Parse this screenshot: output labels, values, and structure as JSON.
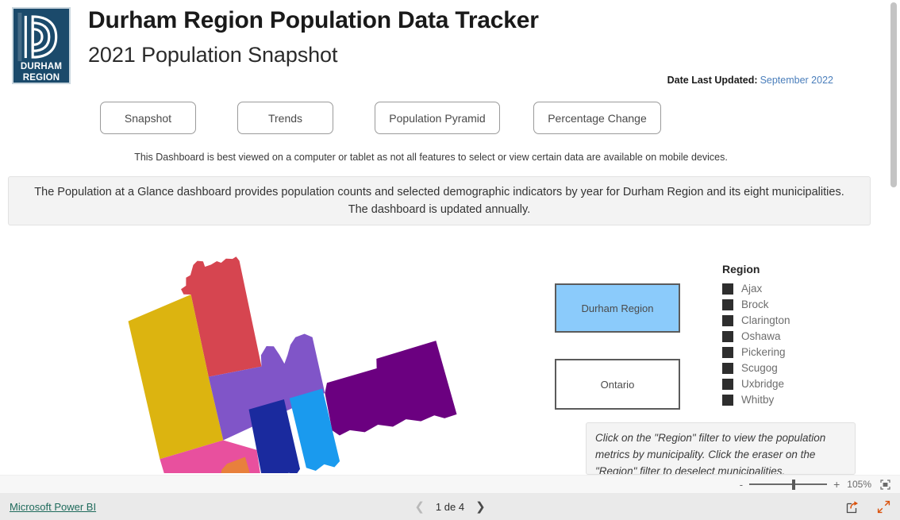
{
  "header": {
    "logo_line1": "DURHAM",
    "logo_line2": "REGION",
    "logo_name": "durham-region-logo",
    "title": "Durham Region Population Data Tracker",
    "subtitle": "2021 Population Snapshot",
    "date_label": "Date Last Updated:",
    "date_value": "September 2022"
  },
  "nav": {
    "buttons": [
      {
        "label": "Snapshot"
      },
      {
        "label": "Trends"
      },
      {
        "label": "Population Pyramid"
      },
      {
        "label": "Percentage Change"
      }
    ]
  },
  "notice": "This Dashboard is best viewed on a computer or tablet as not all features to select or view certain data are available on mobile devices.",
  "description": "The Population at a Glance dashboard provides population counts and selected demographic indicators by year for Durham Region and its eight municipalities. The dashboard is updated annually.",
  "region_toggles": [
    {
      "label": "Durham Region",
      "selected": true,
      "fill": "#8bcbfb"
    },
    {
      "label": "Ontario",
      "selected": false,
      "fill": "#ffffff"
    }
  ],
  "legend": {
    "title": "Region",
    "swatch_color": "#2e2e2e",
    "items": [
      {
        "label": "Ajax"
      },
      {
        "label": "Brock"
      },
      {
        "label": "Clarington"
      },
      {
        "label": "Oshawa"
      },
      {
        "label": "Pickering"
      },
      {
        "label": "Scugog"
      },
      {
        "label": "Uxbridge"
      },
      {
        "label": "Whitby"
      }
    ]
  },
  "note_box": {
    "text": "Click on the \"Region\" filter to view the population metrics by municipality. Click the eraser on the \"Region\" filter to deselect municipalities."
  },
  "map": {
    "name": "durham-region-choropleth-map",
    "regions": [
      {
        "name": "Brock",
        "color": "#d64550"
      },
      {
        "name": "Uxbridge",
        "color": "#dcb410"
      },
      {
        "name": "Scugog",
        "color": "#8055c8"
      },
      {
        "name": "Clarington",
        "color": "#6b0080"
      },
      {
        "name": "Pickering",
        "color": "#e8509e"
      },
      {
        "name": "Whitby",
        "color": "#1a2a9e"
      },
      {
        "name": "Oshawa",
        "color": "#1a9aee"
      },
      {
        "name": "Ajax",
        "color": "#e8803c"
      }
    ]
  },
  "zoombar": {
    "minus": "-",
    "plus": "+",
    "level": "105%",
    "fit_icon": "fit-to-page-icon"
  },
  "footer": {
    "brand": "Microsoft Power BI",
    "page_label": "1 de 4",
    "prev_icon": "chevron-left-icon",
    "next_icon": "chevron-right-icon",
    "share_icon": "share-icon",
    "fullscreen_icon": "fullscreen-icon"
  }
}
